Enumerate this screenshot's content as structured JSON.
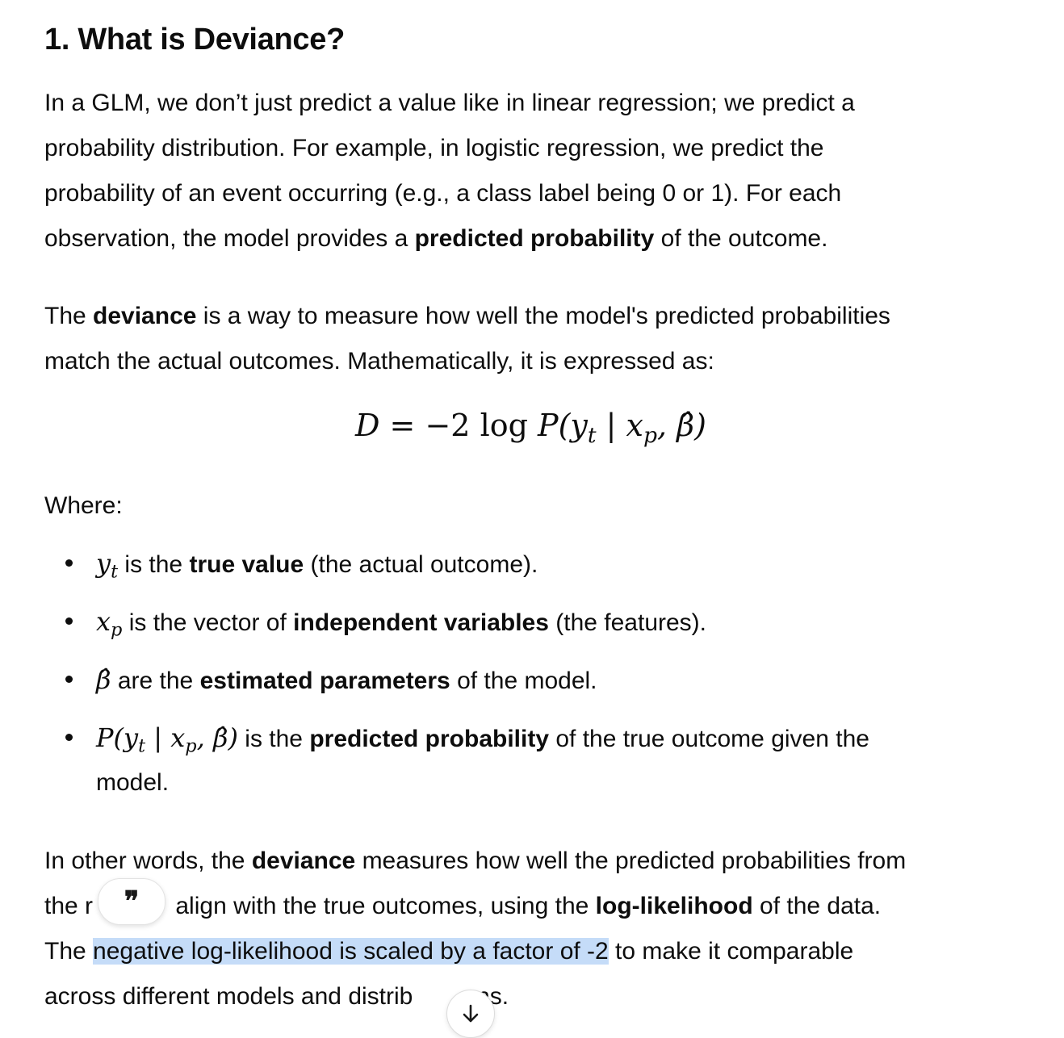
{
  "heading": "1. What is Deviance?",
  "para1": {
    "line1": "In a GLM, we don’t just predict a value like in linear regression; we predict a",
    "line2": "probability distribution. For example, in logistic regression, we predict the",
    "line3": "probability of an event occurring (e.g., a class label being 0 or 1). For each",
    "line4_pre": "observation, the model provides a ",
    "line4_bold": "predicted probability",
    "line4_post": " of the outcome."
  },
  "para2": {
    "line1_pre": "The ",
    "line1_bold": "deviance",
    "line1_post": " is a way to measure how well the model's predicted probabilities",
    "line2": "match the actual outcomes. Mathematically, it is expressed as:"
  },
  "formula": {
    "lhs": "D",
    "eq": " = −2 ",
    "log": "log",
    "p": " P",
    "args": "(y",
    "sub_t": "t",
    "bar": " | x",
    "sub_p": "p",
    "comma": ", ",
    "beta": "β̂",
    "close": ")"
  },
  "where_label": "Where:",
  "bullets": [
    {
      "sym": "y",
      "sub": "t",
      "pre": " is the ",
      "bold": "true value",
      "post": " (the actual outcome)."
    },
    {
      "sym": "x",
      "sub": "p",
      "pre": " is the vector of ",
      "bold": "independent variables",
      "post": " (the features)."
    },
    {
      "sym": "β̂",
      "pre": " are the ",
      "bold": "estimated parameters",
      "post": " of the model."
    },
    {
      "sym": "P(y",
      "sub": "t",
      "sym2": " | x",
      "sub2": "p",
      "sym3": ", β̂)",
      "pre": " is the ",
      "bold": "predicted probability",
      "post": " of the true outcome given the",
      "line2": "model."
    }
  ],
  "para3": {
    "line1_pre": "In other words, the ",
    "line1_bold": "deviance",
    "line1_post": " measures how well the predicted probabilities from",
    "line2_pre": "the r",
    "line2_mid": " align with the true outcomes, using the ",
    "line2_bold": "log-likelihood",
    "line2_post": " of the data.",
    "line3_pre": "The ",
    "line3_hl": "negative log-likelihood is scaled by a factor of -2",
    "line3_post": " to make it comparable",
    "line4_pre": "across different models and distrib",
    "line4_post": "ons."
  },
  "quote_glyph": "❞"
}
